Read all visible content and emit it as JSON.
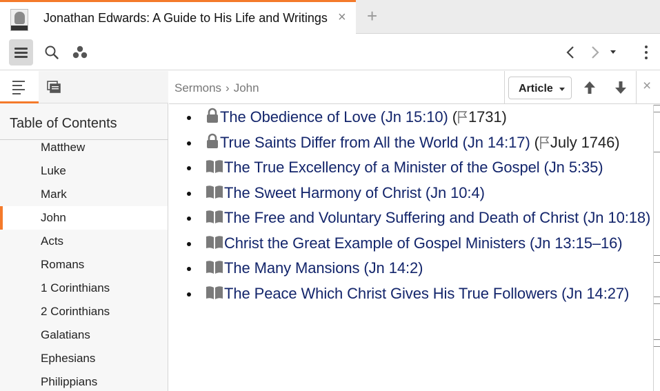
{
  "tab": {
    "title": "Jonathan Edwards: A Guide to His Life and Writings",
    "close_glyph": "×",
    "new_tab_glyph": "+"
  },
  "toolbar": {
    "icons": [
      "menu-icon",
      "search-icon",
      "panels-icon",
      "back-icon",
      "forward-icon",
      "history-dropdown-icon",
      "more-icon"
    ]
  },
  "left_panel": {
    "tabs": [
      "table-of-contents-icon",
      "sections-icon"
    ],
    "heading": "Table of Contents",
    "items": [
      {
        "label": "Matthew",
        "selected": false
      },
      {
        "label": "Luke",
        "selected": false
      },
      {
        "label": "Mark",
        "selected": false
      },
      {
        "label": "John",
        "selected": true
      },
      {
        "label": "Acts",
        "selected": false
      },
      {
        "label": "Romans",
        "selected": false
      },
      {
        "label": "1 Corinthians",
        "selected": false
      },
      {
        "label": "2 Corinthians",
        "selected": false
      },
      {
        "label": "Galatians",
        "selected": false
      },
      {
        "label": "Ephesians",
        "selected": false
      },
      {
        "label": "Philippians",
        "selected": false
      }
    ]
  },
  "content_header": {
    "breadcrumb": [
      "Sermons",
      "John"
    ],
    "breadcrumb_separator": "›",
    "view_select": "Article",
    "close_glyph": "×"
  },
  "sermons": [
    {
      "icon": "lock-icon",
      "title": "The Obedience of Love",
      "ref": "Jn 15:10",
      "date": "1731",
      "line1": "",
      "line2": ""
    },
    {
      "icon": "lock-icon",
      "title": "True Saints Differ from All the World",
      "ref": "Jn 14:17",
      "date": "July 1746",
      "line1": "",
      "line2": ""
    },
    {
      "icon": "book-icon",
      "title": "The True Excellency of a Minister of the Gospel",
      "ref": "Jn 5:35",
      "date": "",
      "line1": "",
      "line2": ""
    },
    {
      "icon": "book-icon",
      "title": "The Sweet Harmony of Christ",
      "ref": "Jn 10:4",
      "date": "",
      "line1": "",
      "line2": ""
    },
    {
      "icon": "book-icon",
      "title": "The Free and Voluntary Suffering and Death of Christ",
      "ref": "Jn 10:18",
      "date": "",
      "line1": "",
      "line2": ""
    },
    {
      "icon": "book-icon",
      "title": "Christ the Great Example of Gospel Ministers",
      "ref": "Jn 13:15–16",
      "date": "",
      "line1": "",
      "line2": ""
    },
    {
      "icon": "book-icon",
      "title": "The Many Mansions",
      "ref": "Jn 14:2",
      "date": "",
      "line1": "",
      "line2": ""
    },
    {
      "icon": "book-icon",
      "title": "The Peace Which Christ Gives His True Followers",
      "ref": "Jn 14:27",
      "date": "",
      "line1": "",
      "line2": ""
    }
  ],
  "colors": {
    "accent": "#f47a2b",
    "link": "#13256b",
    "selected_row": "#ffffff",
    "panel_bg": "#f7f7f7"
  }
}
